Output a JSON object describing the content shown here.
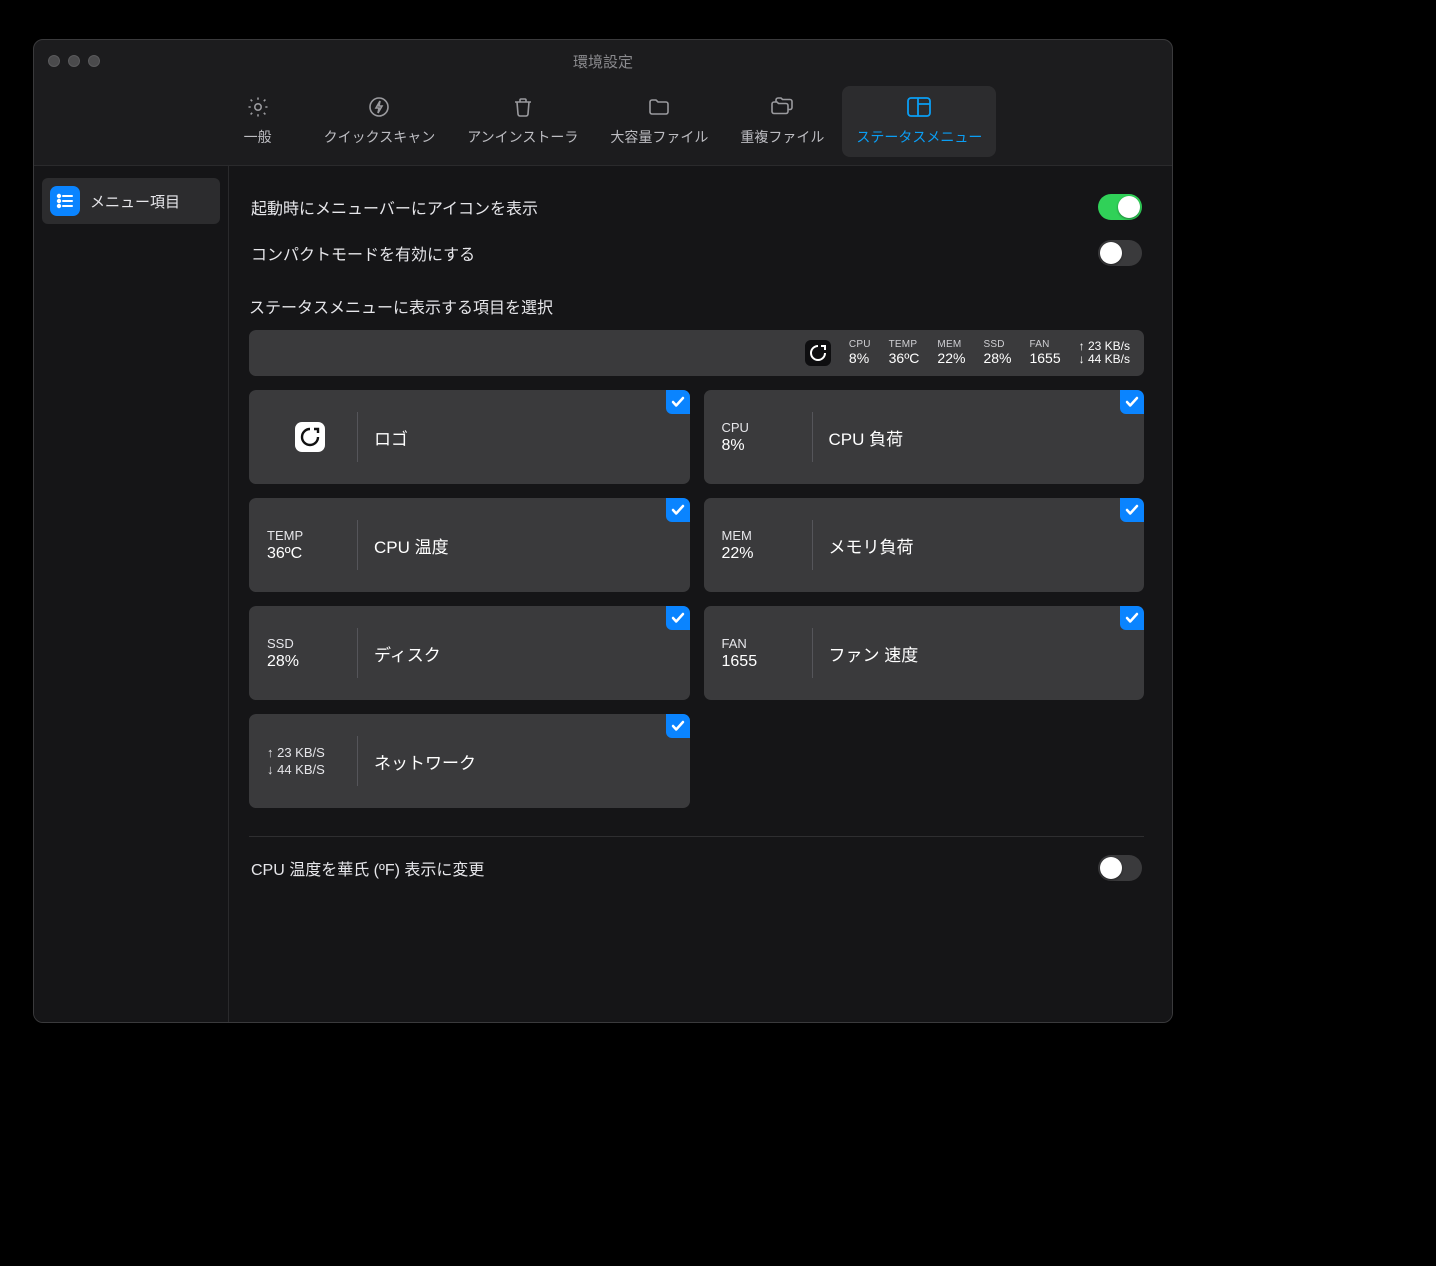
{
  "window": {
    "title": "環境設定"
  },
  "toolbar": {
    "general": "一般",
    "quickscan": "クイックスキャン",
    "uninstaller": "アンインストーラ",
    "largefiles": "大容量ファイル",
    "duplicates": "重複ファイル",
    "statusmenu": "ステータスメニュー"
  },
  "sidebar": {
    "menu_items": "メニュー項目"
  },
  "rows": {
    "show_icon_at_startup": "起動時にメニューバーにアイコンを表示",
    "enable_compact_mode": "コンパクトモードを有効にする",
    "fahrenheit": "CPU 温度を華氏 (ºF) 表示に変更"
  },
  "section_title": "ステータスメニューに表示する項目を選択",
  "preview": {
    "cpu_label": "CPU",
    "cpu_value": "8%",
    "temp_label": "TEMP",
    "temp_value": "36ºC",
    "mem_label": "MEM",
    "mem_value": "22%",
    "ssd_label": "SSD",
    "ssd_value": "28%",
    "fan_label": "FAN",
    "fan_value": "1655",
    "net_up": "↑ 23 KB/s",
    "net_down": "↓ 44 KB/s"
  },
  "cards": {
    "logo": {
      "title": "ロゴ"
    },
    "cpu": {
      "l1": "CPU",
      "l2": "8%",
      "title": "CPU 負荷"
    },
    "temp": {
      "l1": "TEMP",
      "l2": "36ºC",
      "title": "CPU 温度"
    },
    "mem": {
      "l1": "MEM",
      "l2": "22%",
      "title": "メモリ負荷"
    },
    "ssd": {
      "l1": "SSD",
      "l2": "28%",
      "title": "ディスク"
    },
    "fan": {
      "l1": "FAN",
      "l2": "1655",
      "title": "ファン 速度"
    },
    "net": {
      "l1": "↑ 23 KB/S",
      "l2": "↓ 44 KB/S",
      "title": "ネットワーク"
    }
  }
}
